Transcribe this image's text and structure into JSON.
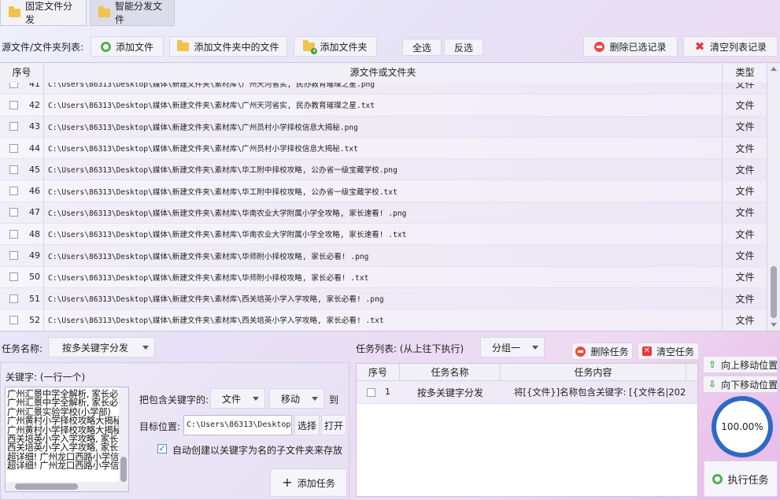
{
  "tabs": [
    {
      "label": "固定文件分发"
    },
    {
      "label": "智能分发文件"
    }
  ],
  "toolbar": {
    "source_label": "源文件/文件夹列表:",
    "add_file": "添加文件",
    "add_files_in_folder": "添加文件夹中的文件",
    "add_folder": "添加文件夹",
    "select_all": "全选",
    "invert_select": "反选",
    "delete_selected": "删除已选记录",
    "clear_list": "清空列表记录"
  },
  "file_table": {
    "headers": {
      "seq": "序号",
      "path": "源文件或文件夹",
      "type": "类型"
    },
    "rows": [
      {
        "seq": "41",
        "path": "C:\\Users\\86313\\Desktop\\媒体\\新建文件夹\\素材库\\广州天河省实, 民办教育璀璨之星.png",
        "type": "文件"
      },
      {
        "seq": "42",
        "path": "C:\\Users\\86313\\Desktop\\媒体\\新建文件夹\\素材库\\广州天河省实, 民办教育璀璨之星.txt",
        "type": "文件"
      },
      {
        "seq": "43",
        "path": "C:\\Users\\86313\\Desktop\\媒体\\新建文件夹\\素材库\\广州员村小学择校信息大揭秘.png",
        "type": "文件"
      },
      {
        "seq": "44",
        "path": "C:\\Users\\86313\\Desktop\\媒体\\新建文件夹\\素材库\\广州员村小学择校信息大揭秘.txt",
        "type": "文件"
      },
      {
        "seq": "45",
        "path": "C:\\Users\\86313\\Desktop\\媒体\\新建文件夹\\素材库\\华工附中择校攻略, 公办省一级宝藏学校.png",
        "type": "文件"
      },
      {
        "seq": "46",
        "path": "C:\\Users\\86313\\Desktop\\媒体\\新建文件夹\\素材库\\华工附中择校攻略, 公办省一级宝藏学校.txt",
        "type": "文件"
      },
      {
        "seq": "47",
        "path": "C:\\Users\\86313\\Desktop\\媒体\\新建文件夹\\素材库\\华南农业大学附属小学全攻略, 家长速看! .png",
        "type": "文件"
      },
      {
        "seq": "48",
        "path": "C:\\Users\\86313\\Desktop\\媒体\\新建文件夹\\素材库\\华南农业大学附属小学全攻略, 家长速看! .txt",
        "type": "文件"
      },
      {
        "seq": "49",
        "path": "C:\\Users\\86313\\Desktop\\媒体\\新建文件夹\\素材库\\华师附小择校攻略, 家长必看! .png",
        "type": "文件"
      },
      {
        "seq": "50",
        "path": "C:\\Users\\86313\\Desktop\\媒体\\新建文件夹\\素材库\\华师附小择校攻略, 家长必看! .txt",
        "type": "文件"
      },
      {
        "seq": "51",
        "path": "C:\\Users\\86313\\Desktop\\媒体\\新建文件夹\\素材库\\西关培英小学入学攻略, 家长必看! .png",
        "type": "文件"
      },
      {
        "seq": "52",
        "path": "C:\\Users\\86313\\Desktop\\媒体\\新建文件夹\\素材库\\西关培英小学入学攻略, 家长必看! .txt",
        "type": "文件"
      }
    ]
  },
  "task_config": {
    "name_label": "任务名称:",
    "name_value": "按多关键字分发",
    "keywords_label": "关键字: (一行一个)",
    "keywords": [
      "广州汇景中学全解析, 家长必",
      "广州汇景中学全解析, 家长必",
      "广州汇景实验学校(小学部)",
      "广州黄村小学择校攻略大揭秘",
      "广州黄村小学择校攻略大揭秘",
      "西关培英小学入学攻略, 家长",
      "西关培英小学入学攻略, 家长",
      "超详细! 广州龙口西路小学信",
      "超详细! 广州龙口西路小学信"
    ],
    "contains_label": "把包含关键字的:",
    "target_type": "文件",
    "action": "移动",
    "to_label": "到",
    "target_label": "目标位置:",
    "target_path": "C:\\Users\\86313\\Desktop\\媒",
    "browse_button": "选择",
    "open_button": "打开",
    "auto_create_checked": true,
    "auto_create_label": "自动创建以关键字为名的子文件夹来存放",
    "add_task_button": "添加任务"
  },
  "task_list": {
    "label": "任务列表: (从上往下执行)",
    "group": "分组一",
    "delete_task": "删除任务",
    "clear_tasks": "清空任务",
    "headers": {
      "seq": "序号",
      "name": "任务名称",
      "content": "任务内容"
    },
    "rows": [
      {
        "seq": "1",
        "name": "按多关键字分发",
        "content": "将[{文件}]名称包含关键字: [{文件名|202"
      }
    ]
  },
  "side": {
    "move_up": "向上移动位置",
    "move_down": "向下移动位置",
    "progress_text": "100.00%",
    "progress_value": 1.0,
    "run_button": "执行任务"
  },
  "colors": {
    "progress_ring": "#2f68c6",
    "accent_green": "#52b04a",
    "danger_red": "#e84c3d"
  }
}
